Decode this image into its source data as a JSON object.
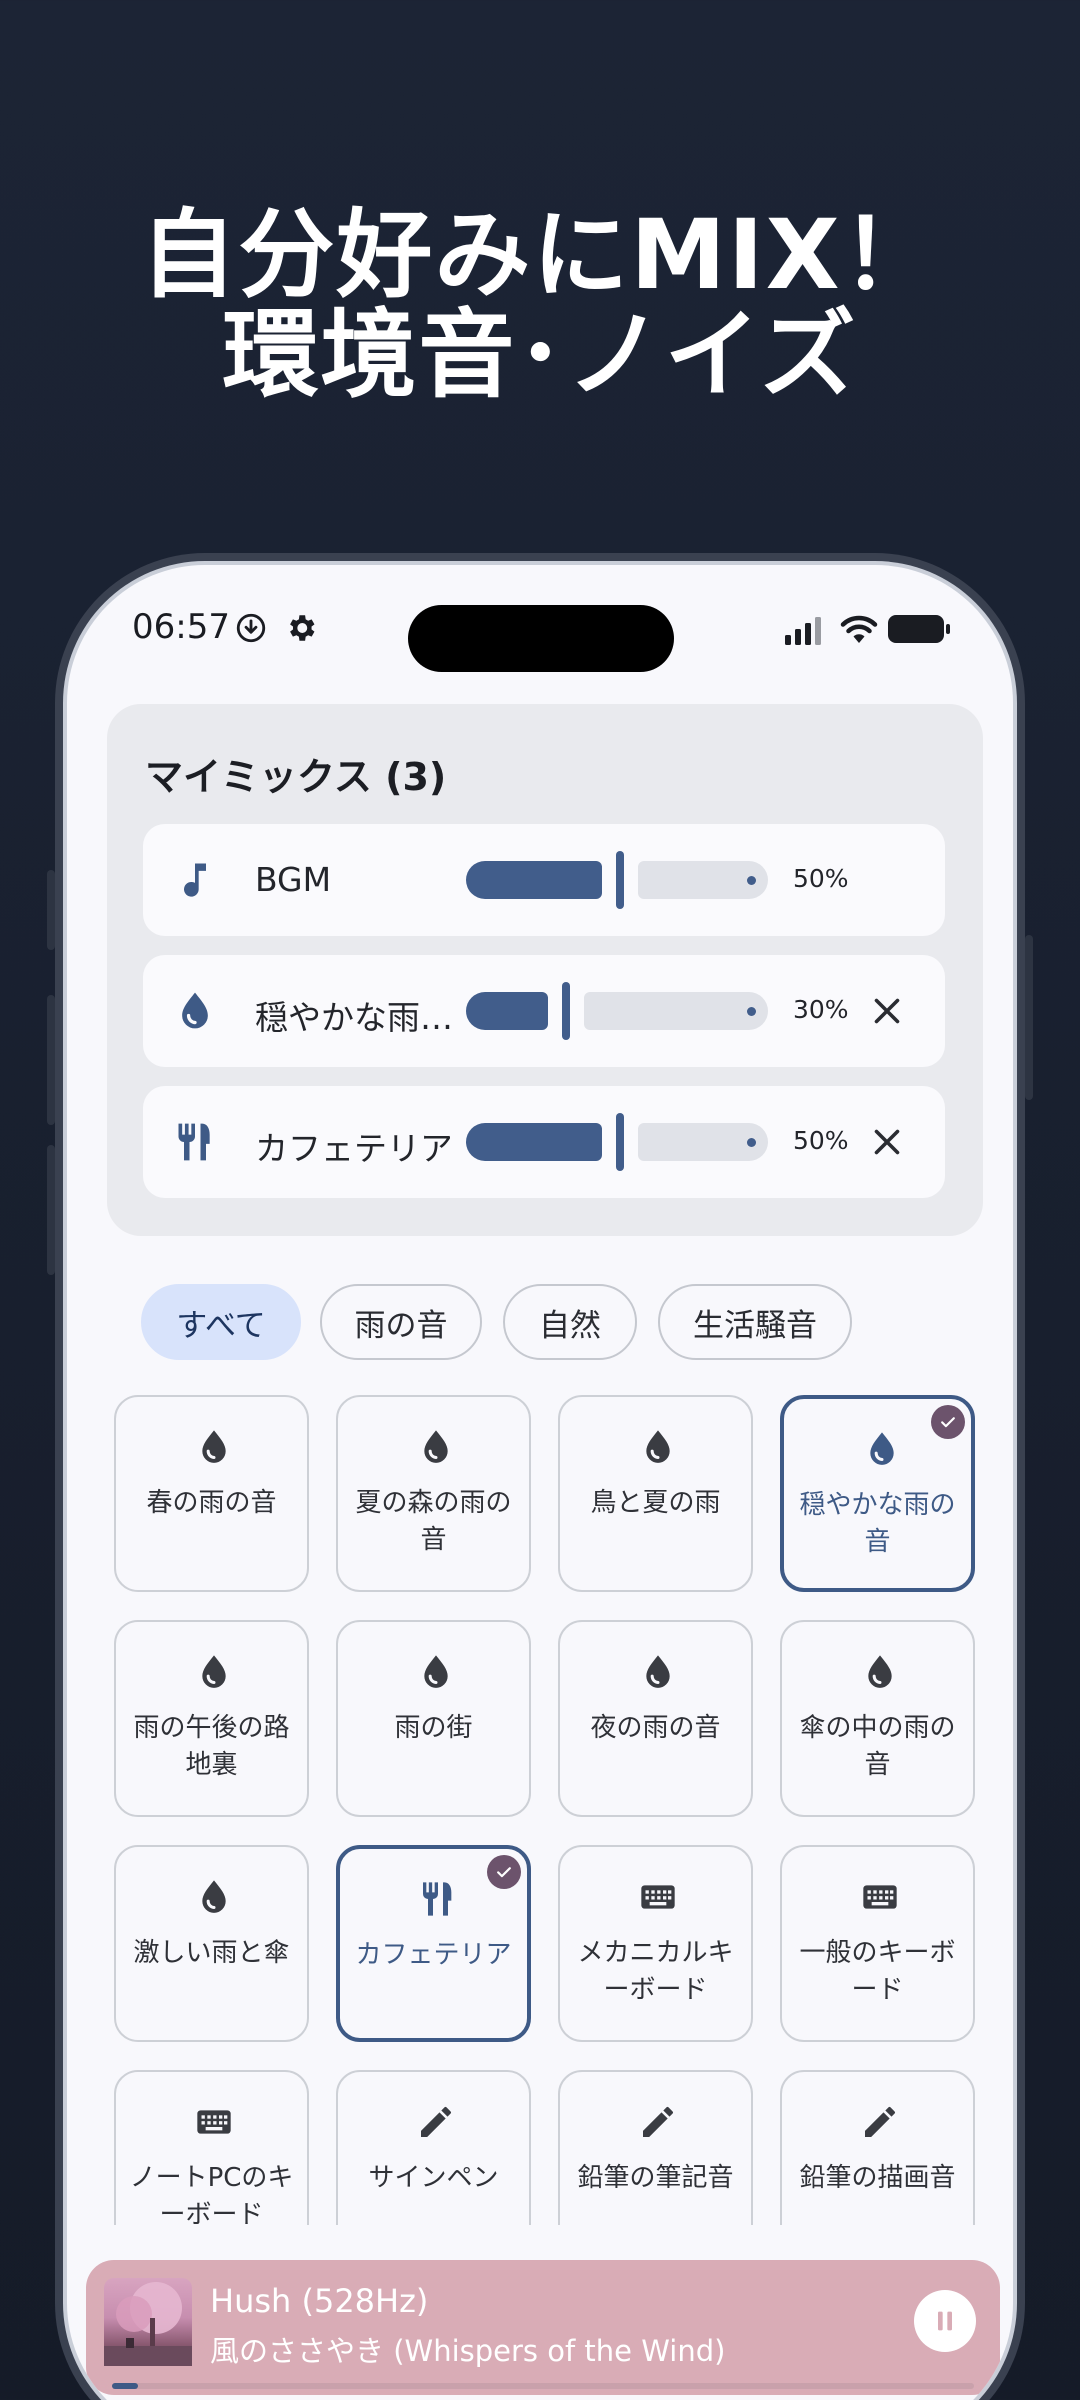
{
  "promo": {
    "line1": "自分好みにMIX！",
    "line2": "環境音･ノイズ"
  },
  "status_bar": {
    "time": "06:57",
    "left_icons": [
      "download-circle-icon",
      "gear-icon"
    ],
    "right_icons": [
      "signal-icon",
      "wifi-icon",
      "battery-icon"
    ]
  },
  "my_mix": {
    "title": "マイミックス (3)",
    "items": [
      {
        "icon": "music-note-icon",
        "name": "BGM",
        "volume_pct": 50,
        "volume_label": "50%",
        "removable": false
      },
      {
        "icon": "water-drop-icon",
        "name": "穏やかな雨…",
        "volume_pct": 30,
        "volume_label": "30%",
        "removable": true
      },
      {
        "icon": "restaurant-icon",
        "name": "カフェテリア",
        "volume_pct": 50,
        "volume_label": "50%",
        "removable": true
      }
    ]
  },
  "filters": {
    "chips": [
      "すべて",
      "雨の音",
      "自然",
      "生活騒音"
    ],
    "active": "すべて"
  },
  "sounds": [
    {
      "label": "春の雨の音",
      "icon": "water-drop-icon",
      "selected": false
    },
    {
      "label": "夏の森の雨の音",
      "icon": "water-drop-icon",
      "selected": false
    },
    {
      "label": "鳥と夏の雨",
      "icon": "water-drop-icon",
      "selected": false
    },
    {
      "label": "穏やかな雨の音",
      "icon": "water-drop-icon",
      "selected": true
    },
    {
      "label": "雨の午後の路地裏",
      "icon": "water-drop-icon",
      "selected": false
    },
    {
      "label": "雨の街",
      "icon": "water-drop-icon",
      "selected": false
    },
    {
      "label": "夜の雨の音",
      "icon": "water-drop-icon",
      "selected": false
    },
    {
      "label": "傘の中の雨の音",
      "icon": "water-drop-icon",
      "selected": false
    },
    {
      "label": "激しい雨と傘",
      "icon": "water-drop-icon",
      "selected": false
    },
    {
      "label": "カフェテリア",
      "icon": "restaurant-icon",
      "selected": true
    },
    {
      "label": "メカニカルキーボード",
      "icon": "keyboard-icon",
      "selected": false
    },
    {
      "label": "一般のキーボード",
      "icon": "keyboard-icon",
      "selected": false
    },
    {
      "label": "ノートPCのキーボード",
      "icon": "keyboard-icon",
      "selected": false
    },
    {
      "label": "サインペン",
      "icon": "pencil-icon",
      "selected": false
    },
    {
      "label": "鉛筆の筆記音",
      "icon": "pencil-icon",
      "selected": false
    },
    {
      "label": "鉛筆の描画音",
      "icon": "pencil-icon",
      "selected": false
    }
  ],
  "player": {
    "title": "Hush (528Hz)",
    "subtitle": "風のささやき (Whispers of the Wind)",
    "progress": 0.03
  },
  "colors": {
    "accent": "#415d8b",
    "check_badge": "#6c536c",
    "player_bg": "#d9acb6",
    "active_chip": "#d8e3fb"
  }
}
